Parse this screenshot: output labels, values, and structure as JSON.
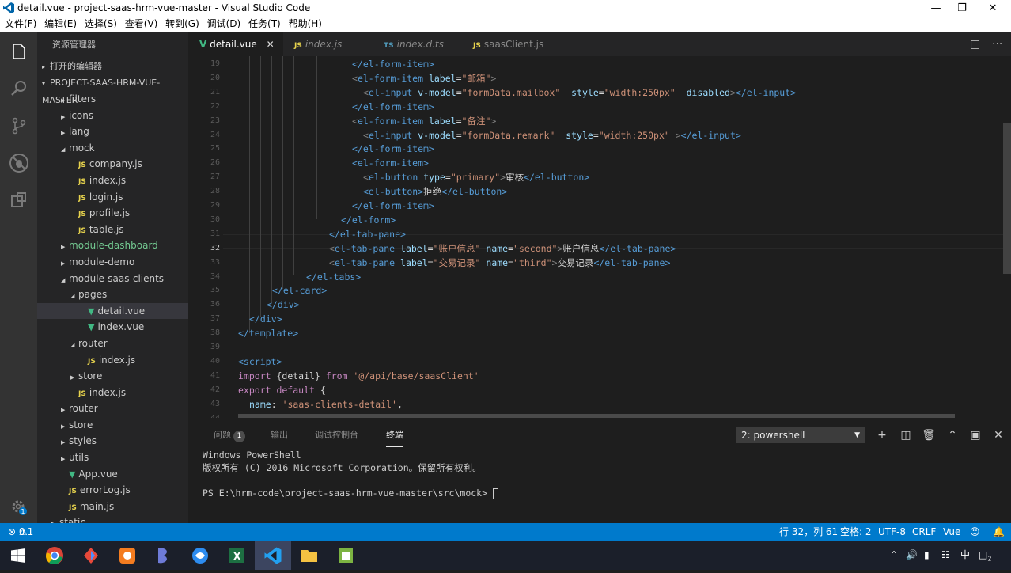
{
  "window": {
    "title": "detail.vue - project-saas-hrm-vue-master - Visual Studio Code"
  },
  "menu": [
    "文件(F)",
    "编辑(E)",
    "选择(S)",
    "查看(V)",
    "转到(G)",
    "调试(D)",
    "任务(T)",
    "帮助(H)"
  ],
  "sidebar": {
    "header": "资源管理器",
    "open_editors": "打开的编辑器",
    "project": "PROJECT-SAAS-HRM-VUE-MASTER",
    "items": [
      {
        "label": "filters",
        "kind": "folder",
        "state": "closed",
        "depth": 1
      },
      {
        "label": "icons",
        "kind": "folder",
        "state": "closed",
        "depth": 1
      },
      {
        "label": "lang",
        "kind": "folder",
        "state": "closed",
        "depth": 1
      },
      {
        "label": "mock",
        "kind": "folder",
        "state": "open",
        "depth": 1
      },
      {
        "label": "company.js",
        "kind": "js",
        "depth": 2
      },
      {
        "label": "index.js",
        "kind": "js",
        "depth": 2
      },
      {
        "label": "login.js",
        "kind": "js",
        "depth": 2
      },
      {
        "label": "profile.js",
        "kind": "js",
        "depth": 2
      },
      {
        "label": "table.js",
        "kind": "js",
        "depth": 2
      },
      {
        "label": "module-dashboard",
        "kind": "folder",
        "state": "closed",
        "depth": 1,
        "color": "#73c991"
      },
      {
        "label": "module-demo",
        "kind": "folder",
        "state": "closed",
        "depth": 1
      },
      {
        "label": "module-saas-clients",
        "kind": "folder",
        "state": "open",
        "depth": 1
      },
      {
        "label": "pages",
        "kind": "folder",
        "state": "open",
        "depth": 2
      },
      {
        "label": "detail.vue",
        "kind": "vue",
        "depth": 3,
        "selected": true
      },
      {
        "label": "index.vue",
        "kind": "vue",
        "depth": 3
      },
      {
        "label": "router",
        "kind": "folder",
        "state": "open",
        "depth": 2
      },
      {
        "label": "index.js",
        "kind": "js",
        "depth": 3
      },
      {
        "label": "store",
        "kind": "folder",
        "state": "closed",
        "depth": 2
      },
      {
        "label": "index.js",
        "kind": "js",
        "depth": 2
      },
      {
        "label": "router",
        "kind": "folder",
        "state": "closed",
        "depth": 1
      },
      {
        "label": "store",
        "kind": "folder",
        "state": "closed",
        "depth": 1
      },
      {
        "label": "styles",
        "kind": "folder",
        "state": "closed",
        "depth": 1
      },
      {
        "label": "utils",
        "kind": "folder",
        "state": "closed",
        "depth": 1
      },
      {
        "label": "App.vue",
        "kind": "vue",
        "depth": 1
      },
      {
        "label": "errorLog.js",
        "kind": "js",
        "depth": 1
      },
      {
        "label": "main.js",
        "kind": "js",
        "depth": 1
      },
      {
        "label": "static",
        "kind": "folder",
        "state": "closed",
        "depth": 0
      }
    ]
  },
  "tabs": [
    {
      "label": "detail.vue",
      "type": "V",
      "active": true
    },
    {
      "label": "index.js",
      "type": "JS",
      "italic": true
    },
    {
      "label": "index.d.ts",
      "type": "TS",
      "italic": true
    },
    {
      "label": "saasClient.js",
      "type": "JS"
    }
  ],
  "editor": {
    "line_numbers": [
      "19",
      "20",
      "21",
      "22",
      "23",
      "24",
      "25",
      "26",
      "27",
      "28",
      "29",
      "30",
      "31",
      "32",
      "33",
      "34",
      "35",
      "36",
      "37",
      "38",
      "39",
      "40",
      "41",
      "42",
      "43",
      "44"
    ],
    "current_line": "32",
    "lines": [
      [
        [
          "tag",
          "</el-form-item>"
        ]
      ],
      [
        [
          "br",
          "<"
        ],
        [
          "tag",
          "el-form-item "
        ],
        [
          "at",
          "label"
        ],
        [
          "tx",
          "="
        ],
        [
          "st",
          "\"邮箱\""
        ],
        [
          "br",
          ">"
        ]
      ],
      [
        [
          "br",
          "<"
        ],
        [
          "tag",
          "el-input "
        ],
        [
          "at",
          "v-model"
        ],
        [
          "tx",
          "="
        ],
        [
          "st",
          "\"formData.mailbox\""
        ],
        [
          "tx",
          "  "
        ],
        [
          "at",
          "style"
        ],
        [
          "tx",
          "="
        ],
        [
          "st",
          "\"width:250px\""
        ],
        [
          "tx",
          "  "
        ],
        [
          "at",
          "disabled"
        ],
        [
          "br",
          ">"
        ],
        [
          "tag",
          "</el-input>"
        ]
      ],
      [
        [
          "tag",
          "</el-form-item>"
        ]
      ],
      [
        [
          "br",
          "<"
        ],
        [
          "tag",
          "el-form-item "
        ],
        [
          "at",
          "label"
        ],
        [
          "tx",
          "="
        ],
        [
          "st",
          "\"备注\""
        ],
        [
          "br",
          ">"
        ]
      ],
      [
        [
          "br",
          "<"
        ],
        [
          "tag",
          "el-input "
        ],
        [
          "at",
          "v-model"
        ],
        [
          "tx",
          "="
        ],
        [
          "st",
          "\"formData.remark\""
        ],
        [
          "tx",
          "  "
        ],
        [
          "at",
          "style"
        ],
        [
          "tx",
          "="
        ],
        [
          "st",
          "\"width:250px\""
        ],
        [
          "tx",
          " "
        ],
        [
          "br",
          ">"
        ],
        [
          "tag",
          "</el-input>"
        ]
      ],
      [
        [
          "tag",
          "</el-form-item>"
        ]
      ],
      [
        [
          "tag",
          "<el-form-item>"
        ]
      ],
      [
        [
          "br",
          "<"
        ],
        [
          "tag",
          "el-button "
        ],
        [
          "at",
          "type"
        ],
        [
          "tx",
          "="
        ],
        [
          "st",
          "\"primary\""
        ],
        [
          "br",
          ">"
        ],
        [
          "tx",
          "审核"
        ],
        [
          "tag",
          "</el-button>"
        ]
      ],
      [
        [
          "tag",
          "<el-button>"
        ],
        [
          "tx",
          "拒绝"
        ],
        [
          "tag",
          "</el-button>"
        ]
      ],
      [
        [
          "tag",
          "</el-form-item>"
        ]
      ],
      [
        [
          "tag",
          "</el-form>"
        ]
      ],
      [
        [
          "tag",
          "</el-tab-pane>"
        ]
      ],
      [
        [
          "br",
          "<"
        ],
        [
          "tag",
          "el-tab-pane "
        ],
        [
          "at",
          "label"
        ],
        [
          "tx",
          "="
        ],
        [
          "st",
          "\"账户信息\""
        ],
        [
          "tx",
          " "
        ],
        [
          "at",
          "name"
        ],
        [
          "tx",
          "="
        ],
        [
          "st",
          "\"second\""
        ],
        [
          "br",
          ">"
        ],
        [
          "tx",
          "账户信息"
        ],
        [
          "tag",
          "</el-tab-pane>"
        ]
      ],
      [
        [
          "br",
          "<"
        ],
        [
          "tag",
          "el-tab-pane "
        ],
        [
          "at",
          "label"
        ],
        [
          "tx",
          "="
        ],
        [
          "st",
          "\"交易记录\""
        ],
        [
          "tx",
          " "
        ],
        [
          "at",
          "name"
        ],
        [
          "tx",
          "="
        ],
        [
          "st",
          "\"third\""
        ],
        [
          "br",
          ">"
        ],
        [
          "tx",
          "交易记录"
        ],
        [
          "tag",
          "</el-tab-pane>"
        ]
      ],
      [
        [
          "tag",
          "</el-tabs>"
        ]
      ],
      [
        [
          "tag",
          "</el-card>"
        ]
      ],
      [
        [
          "tag",
          "</div>"
        ]
      ],
      [
        [
          "tag",
          "</div>"
        ]
      ],
      [
        [
          "tag",
          "</template>"
        ]
      ],
      [],
      [
        [
          "tag",
          "<script>"
        ]
      ],
      [
        [
          "kw",
          "import "
        ],
        [
          "tx",
          "{detail} "
        ],
        [
          "kw",
          "from "
        ],
        [
          "st",
          "'@/api/base/saasClient'"
        ]
      ],
      [
        [
          "kw",
          "export default "
        ],
        [
          "tx",
          "{"
        ]
      ],
      [
        [
          "at",
          "name"
        ],
        [
          "tx",
          ": "
        ],
        [
          "st",
          "'saas-clients-detail'"
        ],
        [
          "tx",
          ","
        ]
      ],
      [
        [
          "tx",
          "data () {"
        ]
      ]
    ]
  },
  "panel": {
    "tabs": [
      {
        "label": "问题",
        "badge": "1"
      },
      {
        "label": "输出"
      },
      {
        "label": "调试控制台"
      },
      {
        "label": "终端",
        "active": true
      }
    ],
    "terminal_select": "2: powershell",
    "terminal_lines": [
      "Windows PowerShell",
      "版权所有 (C) 2016 Microsoft Corporation。保留所有权利。",
      "",
      "PS E:\\hrm-code\\project-saas-hrm-vue-master\\src\\mock> "
    ]
  },
  "status": {
    "errors": "0",
    "warnings": "1",
    "position": "行 32，列 61",
    "spaces": "空格: 2",
    "encoding": "UTF-8",
    "eol": "CRLF",
    "language": "Vue"
  },
  "taskbar": {
    "apps": [
      "start-icon",
      "chrome-icon",
      "app-icon",
      "app-icon",
      "app-icon",
      "app-icon",
      "excel-icon",
      "vscode-icon",
      "explorer-icon",
      "app-icon"
    ],
    "ime": "中",
    "notifications": "2"
  },
  "colors": {
    "accent": "#007acc",
    "sidebar": "#252526",
    "editor": "#1e1e1e"
  }
}
